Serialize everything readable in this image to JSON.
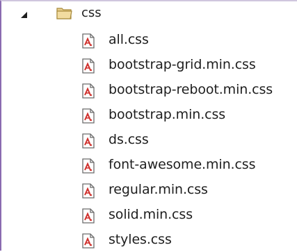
{
  "folder": {
    "name": "css",
    "expanded": true,
    "icon": "folder-icon",
    "expander_icon": "expanded-triangle-icon"
  },
  "files": [
    {
      "name": "all.css",
      "icon": "css-file-icon"
    },
    {
      "name": "bootstrap-grid.min.css",
      "icon": "css-file-icon"
    },
    {
      "name": "bootstrap-reboot.min.css",
      "icon": "css-file-icon"
    },
    {
      "name": "bootstrap.min.css",
      "icon": "css-file-icon"
    },
    {
      "name": "ds.css",
      "icon": "css-file-icon"
    },
    {
      "name": "font-awesome.min.css",
      "icon": "css-file-icon"
    },
    {
      "name": "regular.min.css",
      "icon": "css-file-icon"
    },
    {
      "name": "solid.min.css",
      "icon": "css-file-icon"
    },
    {
      "name": "styles.css",
      "icon": "css-file-icon"
    }
  ],
  "colors": {
    "text": "#1e1e1e",
    "folder": "#d9b76a",
    "file_icon_accent": "#d0312d",
    "frame_border": "#8a6bb0"
  }
}
